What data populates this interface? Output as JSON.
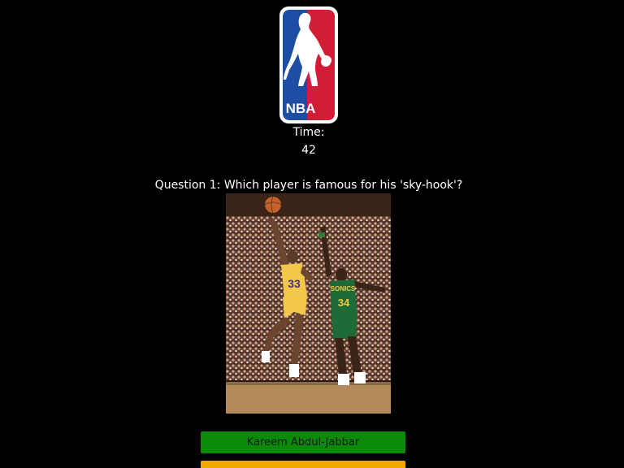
{
  "header": {
    "logo_text": "NBA",
    "logo_icon": "nba-logo-icon"
  },
  "timer": {
    "label": "Time:",
    "value": "42"
  },
  "quiz": {
    "question": "Question 1: Which player is famous for his 'sky-hook'?",
    "image_icon": "basketball-photo",
    "player_jersey_numbers": [
      "33",
      "34"
    ],
    "opponent_team_text": "SONICS"
  },
  "answers": [
    {
      "label": "Kareem Abdul-Jabbar",
      "color": "#0a8a0a"
    },
    {
      "label": "",
      "color": "#f0a800"
    }
  ],
  "colors": {
    "background": "#000000",
    "logo_blue": "#1d4ea3",
    "logo_red": "#d11d36"
  }
}
